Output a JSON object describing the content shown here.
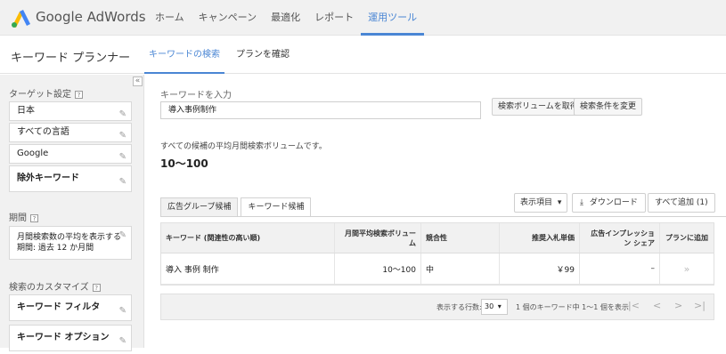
{
  "header": {
    "brand": "Google AdWords",
    "nav": [
      "ホーム",
      "キャンペーン",
      "最適化",
      "レポート",
      "運用ツール"
    ],
    "active_nav": "運用ツール",
    "colors": {
      "accent": "#4a86d4",
      "logo_blue": "#4285f4",
      "logo_green": "#34a853",
      "logo_yellow": "#fbbc05"
    }
  },
  "subheader": {
    "title": "キーワード プランナー",
    "tabs": [
      "キーワードの検索",
      "プランを確認"
    ]
  },
  "sidebar": {
    "collapse_icon": "«",
    "targeting": {
      "title": "ターゲット設定",
      "help": "?",
      "items": [
        "日本",
        "すべての言語",
        "Google",
        "除外キーワード"
      ]
    },
    "period": {
      "title": "期間",
      "help": "?",
      "line1": "月間検索数の平均を表示する",
      "line2": "期間: 過去 12 か月間"
    },
    "customize": {
      "title": "検索のカスタマイズ",
      "help": "?",
      "items": [
        "キーワード フィルタ",
        "キーワード オプション"
      ]
    },
    "icons": {
      "edit": "pencil-icon"
    }
  },
  "search": {
    "label": "キーワードを入力",
    "value": "導入事例制作",
    "get_volume_button": "検索ボリュームを取得",
    "change_conditions_button": "検索条件を変更"
  },
  "summary": {
    "note": "すべての候補の平均月間検索ボリュームです。",
    "value": "10〜100"
  },
  "results": {
    "tabs": [
      "広告グループ候補",
      "キーワード候補"
    ],
    "active_tab": "キーワード候補",
    "columns_button": "表示項目",
    "download_button": "ダウンロード",
    "add_all_button": "すべて追加 (1)",
    "headers": [
      "キーワード (関連性の高い順)",
      "月間平均検索ボリューム",
      "競合性",
      "推奨入札単価",
      "広告インプレッション シェア",
      "プランに追加"
    ],
    "rows": [
      {
        "keyword": "導入 事例 制作",
        "volume": "10〜100",
        "competition": "中",
        "bid": "￥99",
        "share": "–",
        "add": "»"
      }
    ]
  },
  "pager": {
    "rows_label": "表示する行数:",
    "rows_value": "30",
    "range": "1 個のキーワード中 1〜1 個を表示",
    "first": "|<",
    "prev": "<",
    "next": ">",
    "last": ">|"
  }
}
